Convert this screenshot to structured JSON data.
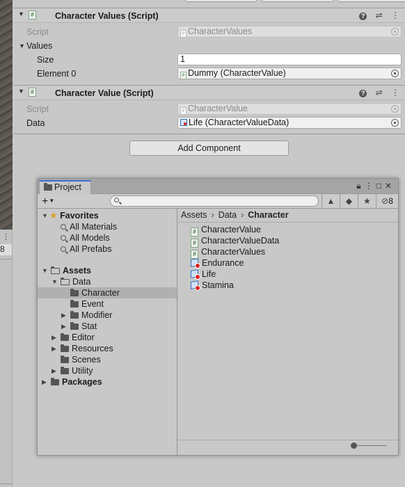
{
  "left_strip": {
    "dots": "⋮",
    "number": "8"
  },
  "components": [
    {
      "title": "Character Values (Script)",
      "rows": [
        {
          "label": "Script",
          "value": "CharacterValues"
        },
        {
          "label": "Values"
        },
        {
          "label": "Size",
          "value": "1"
        },
        {
          "label": "Element 0",
          "value": "Dummy (CharacterValue)"
        }
      ]
    },
    {
      "title": "Character Value (Script)",
      "rows": [
        {
          "label": "Script",
          "value": "CharacterValue"
        },
        {
          "label": "Data",
          "value": "Life (CharacterValueData)"
        }
      ]
    }
  ],
  "add_component_label": "Add Component",
  "project": {
    "tab_label": "Project",
    "hidden_count": "8",
    "favorites": {
      "label": "Favorites",
      "items": [
        "All Materials",
        "All Models",
        "All Prefabs"
      ]
    },
    "assets_label": "Assets",
    "tree": {
      "data": "Data",
      "character": "Character",
      "event": "Event",
      "modifier": "Modifier",
      "stat": "Stat",
      "editor": "Editor",
      "resources": "Resources",
      "scenes": "Scenes",
      "utility": "Utility"
    },
    "packages_label": "Packages",
    "breadcrumb": [
      "Assets",
      "Data",
      "Character"
    ],
    "assets": [
      {
        "name": "CharacterValue",
        "icon": "script-icon"
      },
      {
        "name": "CharacterValueData",
        "icon": "script-icon"
      },
      {
        "name": "CharacterValues",
        "icon": "script-icon"
      },
      {
        "name": "Endurance",
        "icon": "scriptable-object-icon"
      },
      {
        "name": "Life",
        "icon": "scriptable-object-icon"
      },
      {
        "name": "Stamina",
        "icon": "scriptable-object-icon"
      }
    ],
    "zoom": 0
  },
  "colors": {
    "accent_tab": "#3a72d6",
    "selection": "#b0b0b0",
    "panel_bg": "#c8c8c8"
  }
}
